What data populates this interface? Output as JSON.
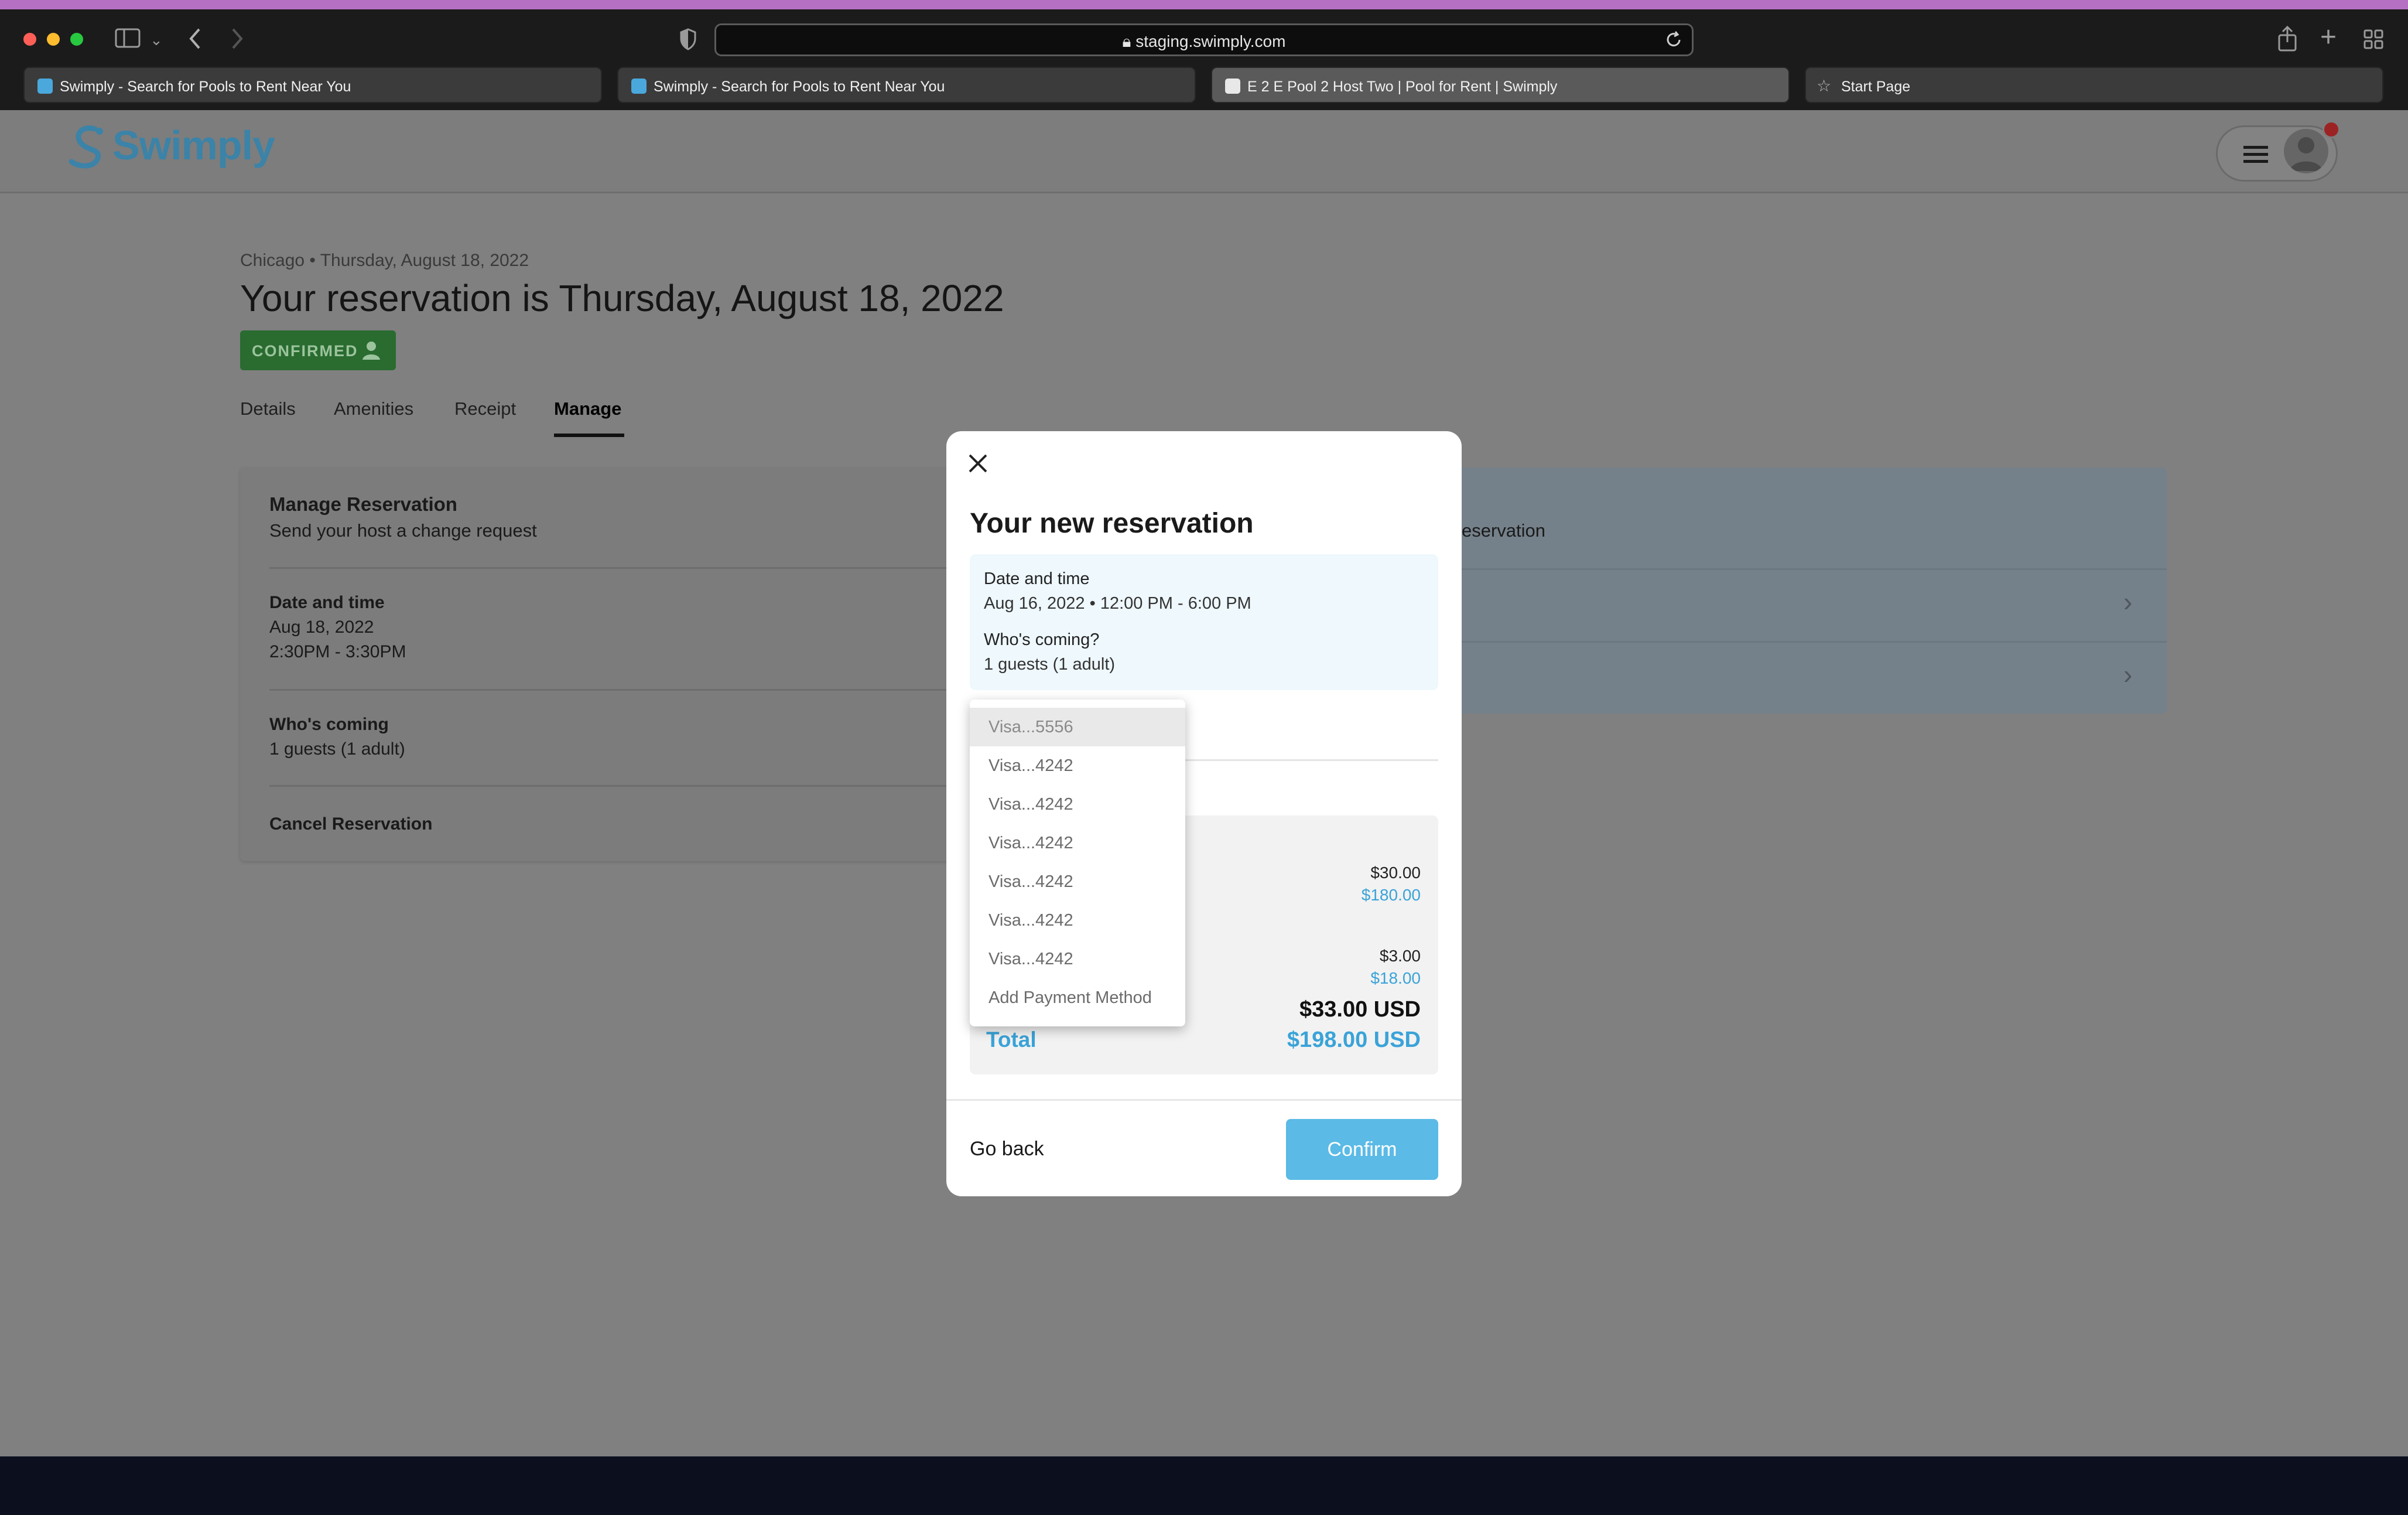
{
  "browser": {
    "url": "staging.swimply.com",
    "tabs": [
      {
        "title": "Swimply - Search for Pools to Rent Near You"
      },
      {
        "title": "Swimply - Search for Pools to Rent Near You"
      },
      {
        "title": "E 2 E Pool 2 Host Two | Pool for Rent | Swimply"
      },
      {
        "title": "Start Page"
      }
    ]
  },
  "site": {
    "logo": "Swimply"
  },
  "reservation": {
    "breadcrumb": "Chicago • Thursday, August 18, 2022",
    "title": "Your reservation is Thursday, August 18, 2022",
    "status": "CONFIRMED",
    "tabs": [
      "Details",
      "Amenities",
      "Receipt",
      "Manage"
    ],
    "active_tab": "Manage"
  },
  "manage_card": {
    "title": "Manage Reservation",
    "subtitle": "Send your host a change request",
    "date_label": "Date and time",
    "date_value": "Aug 18, 2022",
    "time_value": "2:30PM - 3:30PM",
    "guests_label": "Who's coming",
    "guests_value": "1 guests (1 adult)",
    "cancel": "Cancel Reservation",
    "right_fragment": "eservation"
  },
  "modal": {
    "title": "Your new reservation",
    "date_label": "Date and time",
    "date_value": "Aug 16, 2022 • 12:00 PM - 6:00 PM",
    "guests_label": "Who's coming?",
    "guests_value": "1 guests (1 adult)",
    "line1_old": "$30.00",
    "line1_new": "$180.00",
    "line2_old": "$3.00",
    "line2_new": "$18.00",
    "total_old": "$33.00 USD",
    "total_label": "Total",
    "total_new": "$198.00 USD",
    "go_back": "Go back",
    "confirm": "Confirm"
  },
  "payment_dropdown": {
    "options": [
      "Visa...5556",
      "Visa...4242",
      "Visa...4242",
      "Visa...4242",
      "Visa...4242",
      "Visa...4242",
      "Visa...4242",
      "Add Payment Method"
    ],
    "highlighted": "Visa...5556"
  },
  "colors": {
    "brand": "#3b83a8",
    "confirm_button": "#5bbae6",
    "confirmed_badge": "#2a6b30",
    "price_new": "#3aa3d8"
  }
}
